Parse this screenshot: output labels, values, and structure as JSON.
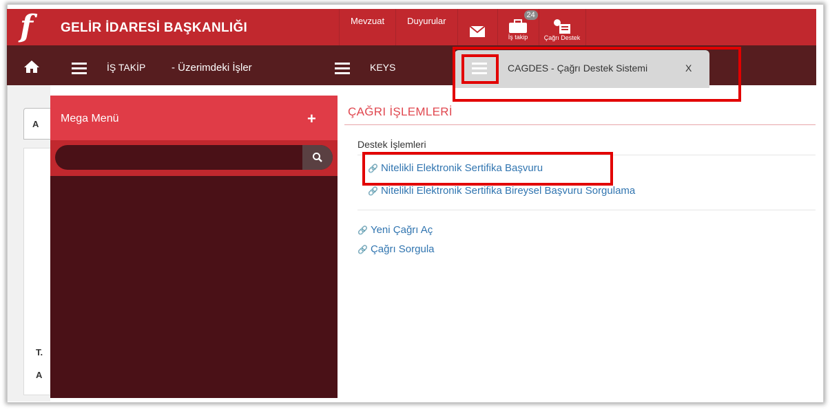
{
  "header": {
    "brand": "GELİR İDARESİ BAŞKANLIĞI",
    "nav": [
      "Mevzuat",
      "Duyurular"
    ],
    "mail_icon": "envelope-icon",
    "is_takip": {
      "label": "İş takip",
      "badge": "24",
      "icon": "briefcase-icon"
    },
    "cagri_destek": {
      "label": "Çağrı Destek",
      "icon": "support-form-icon"
    },
    "brand_color": "#c1282e"
  },
  "second_bar": {
    "home_icon": "home-icon",
    "is_takip_label": "İŞ TAKİP",
    "uzerimdeki": "- Üzerimdeki İşler",
    "keys_label": "KEYS",
    "active_tab": {
      "label": "CAGDES - Çağrı Destek Sistemi",
      "close": "X"
    }
  },
  "left_panel": {
    "tab_letter": "A",
    "line1": "T.",
    "line2": "A"
  },
  "mega_menu": {
    "title": "Mega Menü",
    "plus": "+",
    "search_placeholder": "",
    "search_icon": "search-icon"
  },
  "content": {
    "title": "ÇAĞRI İŞLEMLERİ",
    "section": "Destek İşlemleri",
    "links_group1": [
      "Nitelikli Elektronik Sertifika Başvuru",
      "Nitelikli Elektronik Sertifika Bireysel Başvuru Sorgulama"
    ],
    "links_group2": [
      "Yeni Çağrı Aç",
      "Çağrı Sorgula"
    ]
  }
}
